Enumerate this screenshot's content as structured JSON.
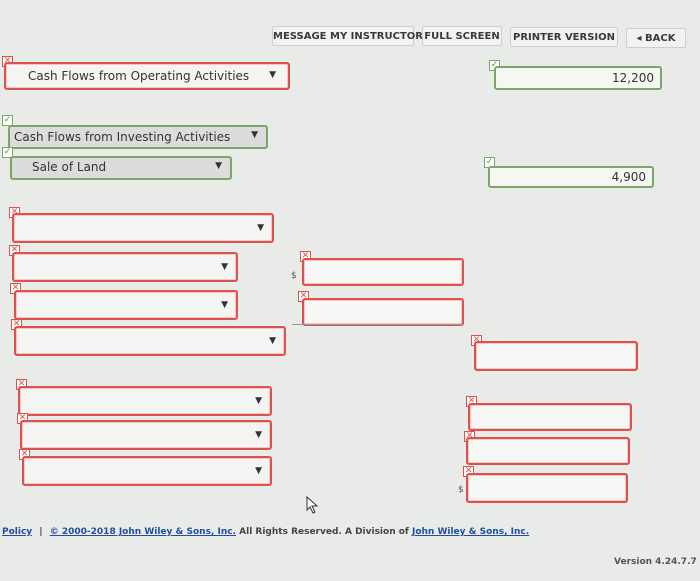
{
  "toolbar": {
    "message_instructor": "MESSAGE MY INSTRUCTOR",
    "full_screen": "FULL SCREEN",
    "printer_version": "PRINTER VERSION",
    "back": "BACK"
  },
  "form": {
    "operating_label": "Cash Flows from Operating Activities",
    "operating_value": "12,200",
    "investing_label": "Cash Flows from Investing Activities",
    "sale_of_land_label": "Sale of Land",
    "sale_of_land_value": "4,900",
    "currency_symbol": "$"
  },
  "footer": {
    "policy": "Policy",
    "separator": "|",
    "copyright": "© 2000-2018 John Wiley & Sons, Inc.",
    "rights": "All Rights Reserved. A Division of",
    "company": "John Wiley & Sons, Inc.",
    "version": "Version 4.24.7.7"
  },
  "icons": {
    "error": "x-mark-icon",
    "correct": "check-mark-icon",
    "caret": "caret-down-icon",
    "back": "triangle-left-icon"
  },
  "colors": {
    "error_border": "#d9534f",
    "correct_border": "#7aa66a",
    "link": "#1f4e9c"
  }
}
